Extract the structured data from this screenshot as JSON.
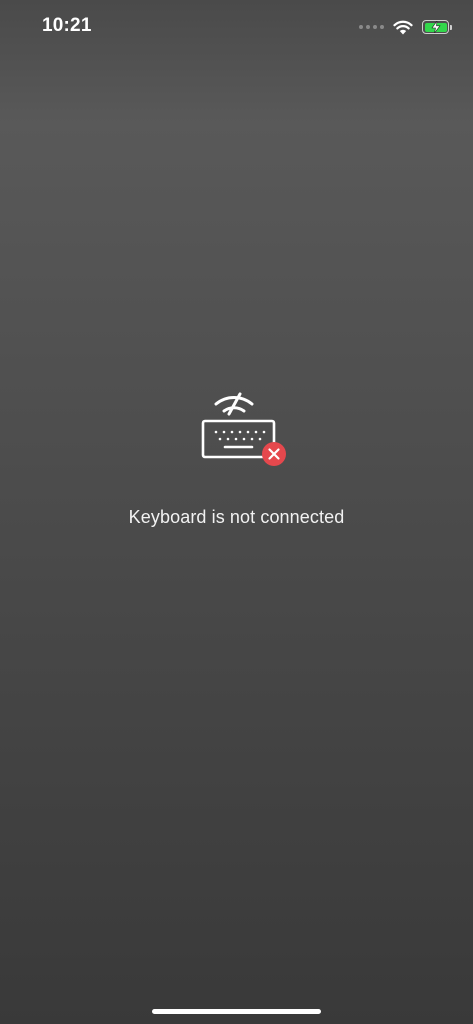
{
  "status_bar": {
    "time": "10:21",
    "icons": [
      "cellular-signal-icon",
      "wifi-icon",
      "battery-charging-icon"
    ],
    "battery_color": "#32d74b"
  },
  "main": {
    "icon": "keyboard-disconnected-icon",
    "error_badge_color": "#e5484d",
    "message": "Keyboard is not connected"
  }
}
